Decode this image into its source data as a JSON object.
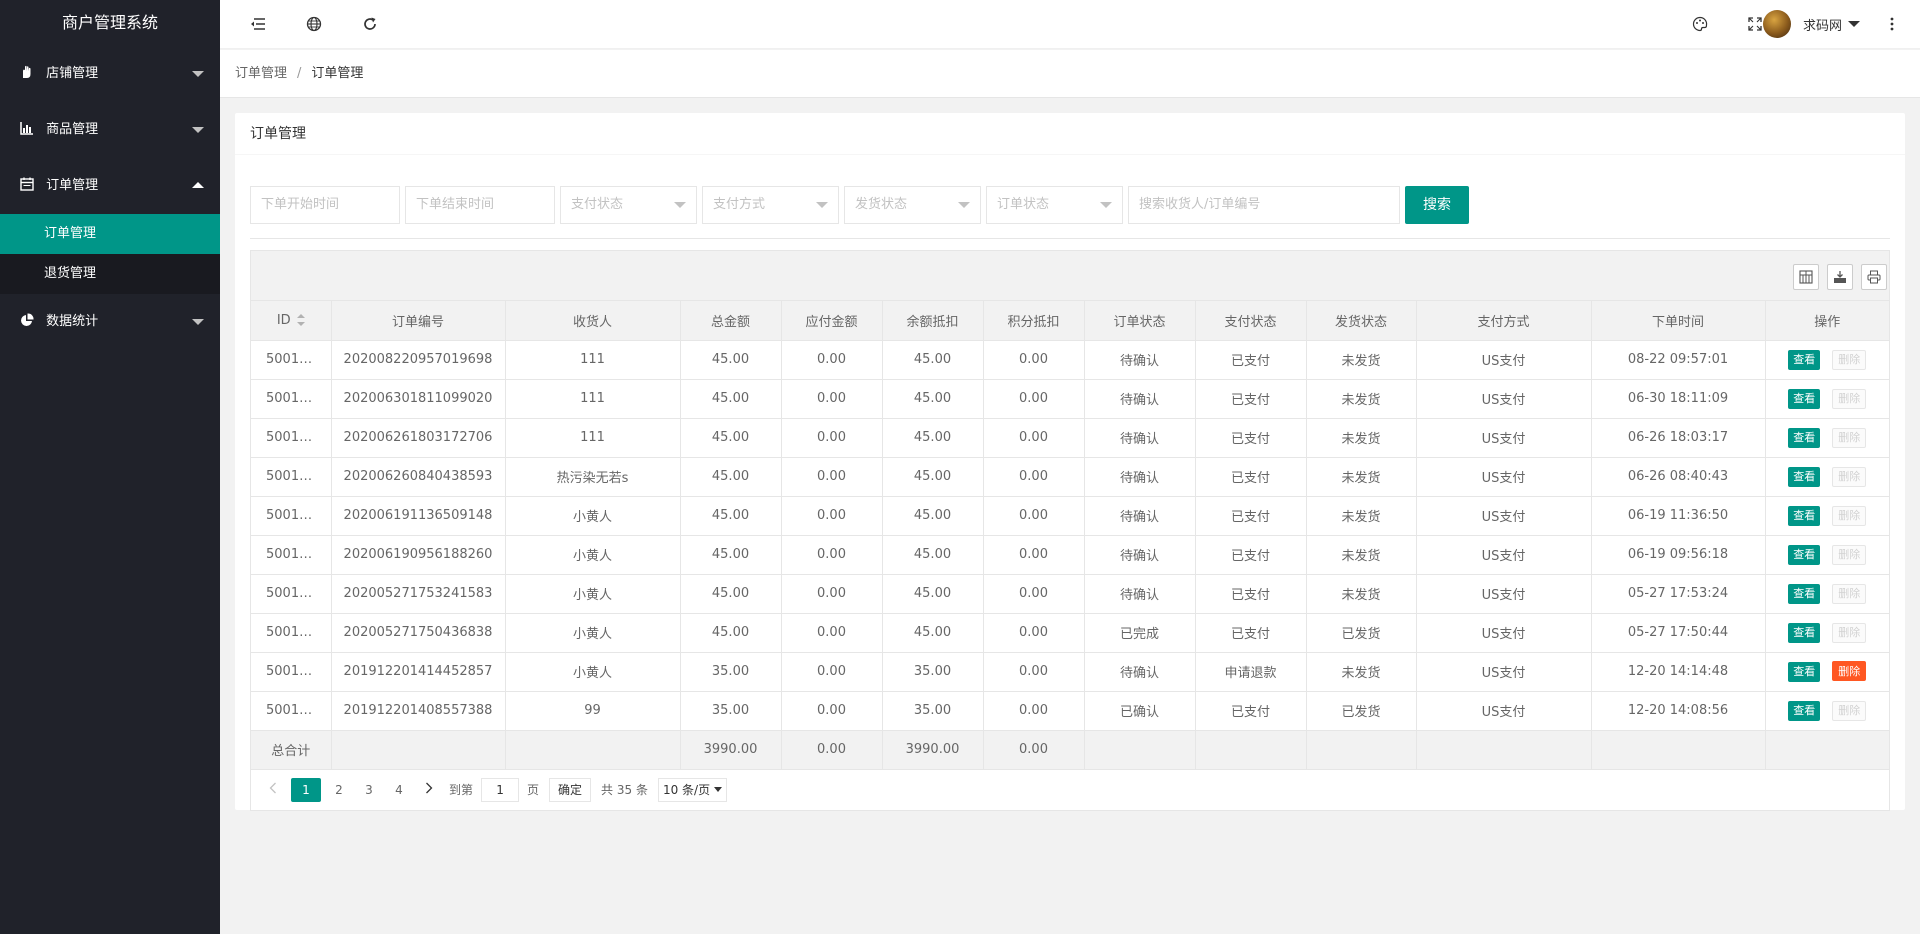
{
  "app": {
    "title": "商户管理系统"
  },
  "sidebar": {
    "items": [
      {
        "label": "店铺管理",
        "icon": "hand-icon",
        "open": false
      },
      {
        "label": "商品管理",
        "icon": "bar-chart-icon",
        "open": false
      },
      {
        "label": "订单管理",
        "icon": "calendar-icon",
        "open": true,
        "children": [
          {
            "label": "订单管理",
            "active": true
          },
          {
            "label": "退货管理",
            "active": false
          }
        ]
      },
      {
        "label": "数据统计",
        "icon": "pie-chart-icon",
        "open": false
      }
    ]
  },
  "header": {
    "icons": [
      "collapse-menu-icon",
      "globe-icon",
      "refresh-icon",
      "theme-icon",
      "fullscreen-icon",
      "more-icon"
    ],
    "user_name": "求码网"
  },
  "breadcrumb": {
    "parent": "订单管理",
    "sep": "/",
    "current": "订单管理"
  },
  "card": {
    "title": "订单管理"
  },
  "filters": {
    "start_time_placeholder": "下单开始时间",
    "end_time_placeholder": "下单结束时间",
    "pay_status_placeholder": "支付状态",
    "pay_method_placeholder": "支付方式",
    "ship_status_placeholder": "发货状态",
    "order_status_placeholder": "订单状态",
    "keyword_placeholder": "搜索收货人/订单编号",
    "search_label": "搜索"
  },
  "table": {
    "toolbar_icons": [
      "columns-icon",
      "export-icon",
      "print-icon"
    ],
    "columns": [
      "ID",
      "订单编号",
      "收货人",
      "总金额",
      "应付金额",
      "余额抵扣",
      "积分抵扣",
      "订单状态",
      "支付状态",
      "发货状态",
      "支付方式",
      "下单时间",
      "操作"
    ],
    "rows": [
      {
        "id": "5001…",
        "order_no": "202008220957019698",
        "receiver": "111",
        "total": "45.00",
        "payable": "0.00",
        "balance": "45.00",
        "points": "0.00",
        "order_status": "待确认",
        "pay_status": "已支付",
        "ship_status": "未发货",
        "pay_method": "US支付",
        "time": "08-22 09:57:01",
        "view": "查看",
        "del": "删除",
        "del_active": false
      },
      {
        "id": "5001…",
        "order_no": "202006301811099020",
        "receiver": "111",
        "total": "45.00",
        "payable": "0.00",
        "balance": "45.00",
        "points": "0.00",
        "order_status": "待确认",
        "pay_status": "已支付",
        "ship_status": "未发货",
        "pay_method": "US支付",
        "time": "06-30 18:11:09",
        "view": "查看",
        "del": "删除",
        "del_active": false
      },
      {
        "id": "5001…",
        "order_no": "202006261803172706",
        "receiver": "111",
        "total": "45.00",
        "payable": "0.00",
        "balance": "45.00",
        "points": "0.00",
        "order_status": "待确认",
        "pay_status": "已支付",
        "ship_status": "未发货",
        "pay_method": "US支付",
        "time": "06-26 18:03:17",
        "view": "查看",
        "del": "删除",
        "del_active": false
      },
      {
        "id": "5001…",
        "order_no": "202006260840438593",
        "receiver": "热污染无若s",
        "total": "45.00",
        "payable": "0.00",
        "balance": "45.00",
        "points": "0.00",
        "order_status": "待确认",
        "pay_status": "已支付",
        "ship_status": "未发货",
        "pay_method": "US支付",
        "time": "06-26 08:40:43",
        "view": "查看",
        "del": "删除",
        "del_active": false
      },
      {
        "id": "5001…",
        "order_no": "202006191136509148",
        "receiver": "小黄人",
        "total": "45.00",
        "payable": "0.00",
        "balance": "45.00",
        "points": "0.00",
        "order_status": "待确认",
        "pay_status": "已支付",
        "ship_status": "未发货",
        "pay_method": "US支付",
        "time": "06-19 11:36:50",
        "view": "查看",
        "del": "删除",
        "del_active": false
      },
      {
        "id": "5001…",
        "order_no": "202006190956188260",
        "receiver": "小黄人",
        "total": "45.00",
        "payable": "0.00",
        "balance": "45.00",
        "points": "0.00",
        "order_status": "待确认",
        "pay_status": "已支付",
        "ship_status": "未发货",
        "pay_method": "US支付",
        "time": "06-19 09:56:18",
        "view": "查看",
        "del": "删除",
        "del_active": false
      },
      {
        "id": "5001…",
        "order_no": "202005271753241583",
        "receiver": "小黄人",
        "total": "45.00",
        "payable": "0.00",
        "balance": "45.00",
        "points": "0.00",
        "order_status": "待确认",
        "pay_status": "已支付",
        "ship_status": "未发货",
        "pay_method": "US支付",
        "time": "05-27 17:53:24",
        "view": "查看",
        "del": "删除",
        "del_active": false
      },
      {
        "id": "5001…",
        "order_no": "202005271750436838",
        "receiver": "小黄人",
        "total": "45.00",
        "payable": "0.00",
        "balance": "45.00",
        "points": "0.00",
        "order_status": "已完成",
        "pay_status": "已支付",
        "ship_status": "已发货",
        "pay_method": "US支付",
        "time": "05-27 17:50:44",
        "view": "查看",
        "del": "删除",
        "del_active": false
      },
      {
        "id": "5001…",
        "order_no": "201912201414452857",
        "receiver": "小黄人",
        "total": "35.00",
        "payable": "0.00",
        "balance": "35.00",
        "points": "0.00",
        "order_status": "待确认",
        "pay_status": "申请退款",
        "ship_status": "未发货",
        "pay_method": "US支付",
        "time": "12-20 14:14:48",
        "view": "查看",
        "del": "删除",
        "del_active": true
      },
      {
        "id": "5001…",
        "order_no": "201912201408557388",
        "receiver": "99",
        "total": "35.00",
        "payable": "0.00",
        "balance": "35.00",
        "points": "0.00",
        "order_status": "已确认",
        "pay_status": "已支付",
        "ship_status": "已发货",
        "pay_method": "US支付",
        "time": "12-20 14:08:56",
        "view": "查看",
        "del": "删除",
        "del_active": false
      }
    ],
    "totals": {
      "label": "总合计",
      "total": "3990.00",
      "payable": "0.00",
      "balance": "3990.00",
      "points": "0.00"
    }
  },
  "pagination": {
    "pages": [
      "1",
      "2",
      "3",
      "4"
    ],
    "current": "1",
    "goto_label": "到第",
    "goto_value": "1",
    "page_unit": "页",
    "confirm_label": "确定",
    "count_text": "共 35 条",
    "page_size": "10 条/页"
  },
  "colors": {
    "accent": "#009688",
    "danger": "#ff5722",
    "sidebar_bg": "#20222a"
  }
}
